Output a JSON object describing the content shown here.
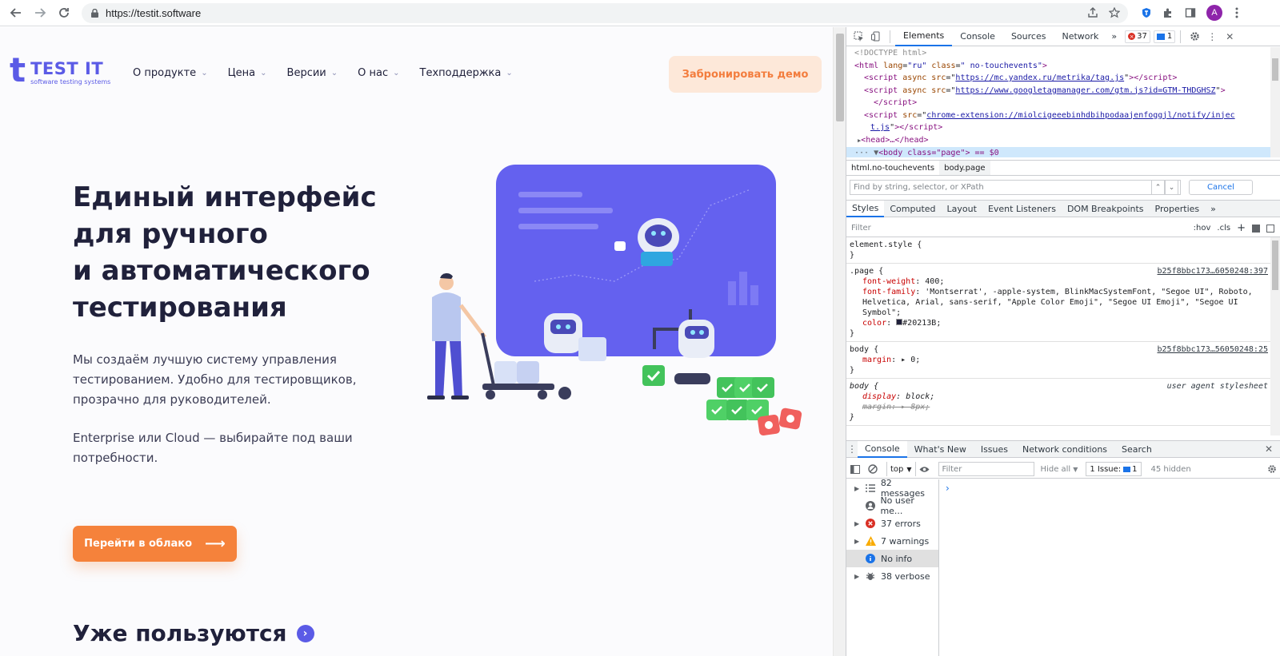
{
  "browser": {
    "url": "https://testit.software",
    "avatar_letter": "A"
  },
  "site": {
    "logo": {
      "letter": "t",
      "name": "TEST IT",
      "tagline": "software testing systems"
    },
    "menu": [
      {
        "label": "О продукте"
      },
      {
        "label": "Цена"
      },
      {
        "label": "Версии"
      },
      {
        "label": "О нас"
      },
      {
        "label": "Техподдержка"
      }
    ],
    "demo_button": "Забронировать демо",
    "hero_title_lines": [
      "Единый интерфейс",
      "для ручного",
      "и автоматического",
      "тестирования"
    ],
    "hero_text": "Мы создаём лучшую систему управления тестированием. Удобно для тестировщиков, прозрачно для руководителей.",
    "hero_text2": "Enterprise или Cloud — выбирайте под ваши потребности.",
    "cloud_button": "Перейти в облако",
    "section_title": "Уже пользуются",
    "colors": {
      "brand": "#5b5be6",
      "accent": "#f5823b",
      "text": "#20213b"
    }
  },
  "devtools": {
    "tabs": [
      "Elements",
      "Console",
      "Sources",
      "Network"
    ],
    "more_tabs": "»",
    "error_count": "37",
    "issue_count": "1",
    "dom": {
      "doctype": "<!DOCTYPE html>",
      "html_open_tag": "html",
      "html_lang_attr": "lang",
      "html_lang_val": "\"ru\"",
      "html_class_attr": "class",
      "html_class_val": "\" no-touchevents\"",
      "script1_src": "https://mc.yandex.ru/metrika/tag.js",
      "script2_src": "https://www.googletagmanager.com/gtm.js?id=GTM-THDGHSZ",
      "script3_src_a": "chrome-extension://miolcigeeebinhdbihpodaajenfoggjl/notify/injec",
      "script3_src_b": "t.js",
      "head_collapsed": "<head>…</head>",
      "body_line": "<body class=\"page\"> == $0"
    },
    "breadcrumbs": [
      "html.no-touchevents",
      "body.page"
    ],
    "find_placeholder": "Find by string, selector, or XPath",
    "cancel_label": "Cancel",
    "styles_tabs": [
      "Styles",
      "Computed",
      "Layout",
      "Event Listeners",
      "DOM Breakpoints",
      "Properties"
    ],
    "styles_filter_placeholder": "Filter",
    "hov_label": ":hov",
    "cls_label": ".cls",
    "rules": {
      "element_style": "element.style {",
      "page_selector": ".page {",
      "page_source": "b25f8bbc173…6050248:397",
      "page_font_weight": "400",
      "page_font_family": "'Montserrat', -apple-system, BlinkMacSystemFont, \"Segoe UI\", Roboto, Helvetica, Arial, sans-serif, \"Apple Color Emoji\", \"Segoe UI Emoji\", \"Segoe UI Symbol\"",
      "page_color": "#20213B",
      "body_selector": "body {",
      "body_source": "b25f8bbc173…56050248:25",
      "body_margin": "0",
      "ua_selector": "body {",
      "ua_source": "user agent stylesheet",
      "ua_display": "block",
      "ua_margin": "8px"
    },
    "drawer_tabs": [
      "Console",
      "What's New",
      "Issues",
      "Network conditions",
      "Search"
    ],
    "console": {
      "context": "top",
      "filter_placeholder": "Filter",
      "levels": "Hide all",
      "issues_label": "1 Issue:",
      "issues_count": "1",
      "hidden": "45 hidden"
    },
    "console_sidebar": [
      {
        "label": "82 messages",
        "icon": "list-icon"
      },
      {
        "label": "No user me...",
        "icon": "user-icon"
      },
      {
        "label": "37 errors",
        "icon": "error-icon"
      },
      {
        "label": "7 warnings",
        "icon": "warning-icon"
      },
      {
        "label": "No info",
        "icon": "info-icon"
      },
      {
        "label": "38 verbose",
        "icon": "bug-icon"
      }
    ]
  }
}
